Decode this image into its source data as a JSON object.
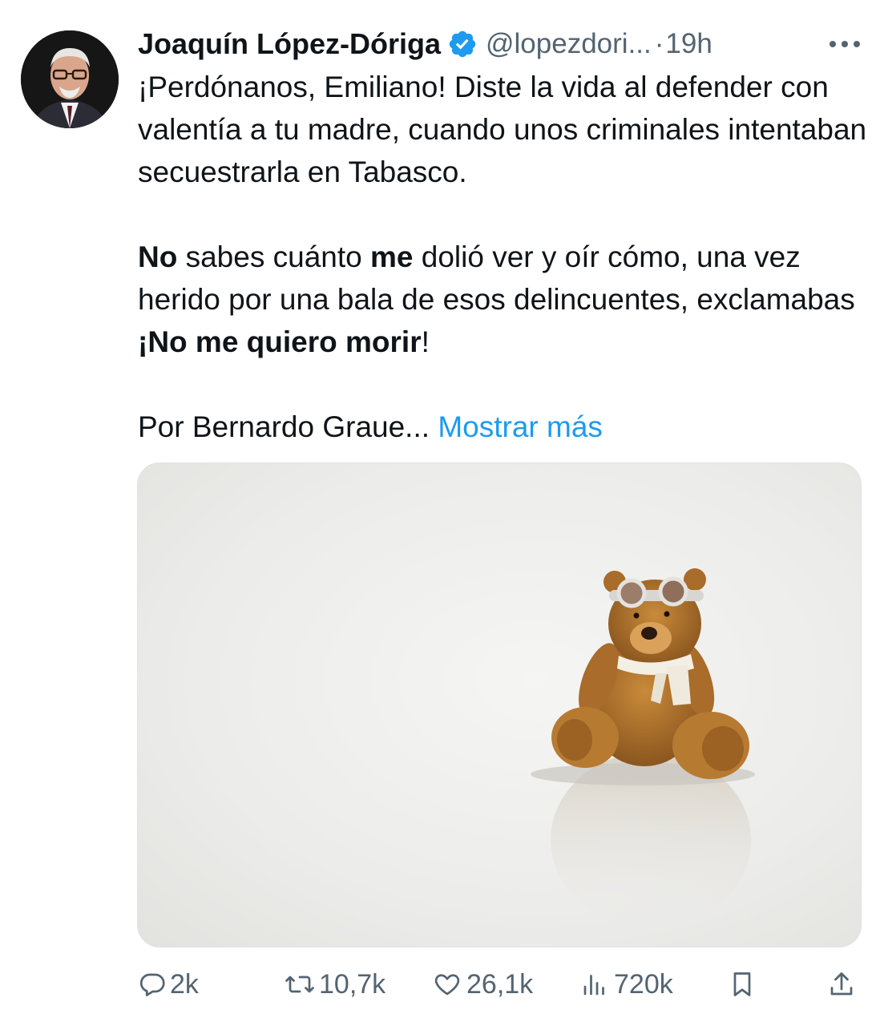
{
  "author": {
    "name": "Joaquín López-Dóriga",
    "handle": "@lopezdori...",
    "separator": "·",
    "time": "19h",
    "verified": true
  },
  "body": {
    "p1": "¡Perdónanos, Emiliano! Diste la vida al defender con valentía a tu madre, cuando unos criminales intentaban secuestrarla en Tabasco.",
    "p2": {
      "b1": "No",
      "t1": " sabes cuánto ",
      "b2": "me",
      "t2": " dolió ver y oír cómo, una vez herido por una bala de esos delincuentes, exclamabas ",
      "b3": "¡No me quiero morir",
      "t3": "!"
    },
    "p3": {
      "text": "Por Bernardo Graue... ",
      "link": "Mostrar más"
    }
  },
  "media": {
    "description_icon": "teddy-bear-image"
  },
  "actions": {
    "replies": "2k",
    "reposts": "10,7k",
    "likes": "26,1k",
    "views": "720k"
  },
  "colors": {
    "accent": "#1d9bf0",
    "secondary_text": "#536471",
    "text": "#0f1419"
  }
}
